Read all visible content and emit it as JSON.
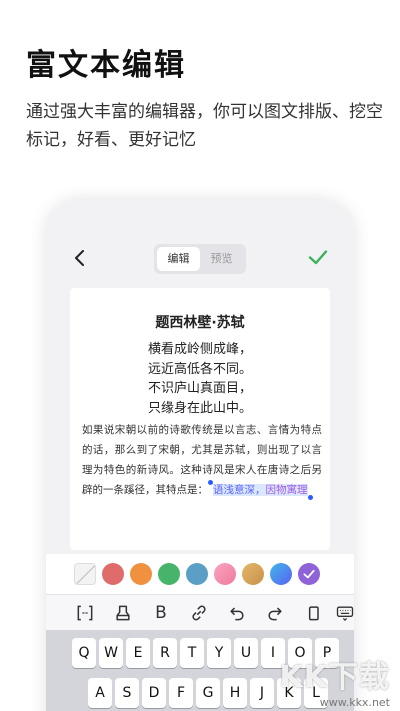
{
  "promo": {
    "title": "富文本编辑",
    "subtitle": "通过强大丰富的编辑器，你可以图文排版、挖空标记，好看、更好记忆"
  },
  "appbar": {
    "back_icon": "chevron-left-icon",
    "segments": [
      {
        "label": "编辑",
        "active": true
      },
      {
        "label": "预览",
        "active": false
      }
    ],
    "confirm_icon": "check-icon",
    "confirm_color": "#3cb15a"
  },
  "document": {
    "poem_title": "题西林壁·苏轼",
    "poem_lines": [
      "横看成岭侧成峰，",
      "远近高低各不同。",
      "不识庐山真面目，",
      "只缘身在此山中。"
    ],
    "paragraph_plain": "如果说宋朝以前的诗歌传统是以言志、言情为特点的话，那么到了宋朝，尤其是苏轼，则出现了以言理为特色的新诗风。这种诗风是宋人在唐诗之后另辟的一条蹊径，其特点是：",
    "highlight_part1": "语浅意深，",
    "highlight_part2": "因物寓理"
  },
  "palette": {
    "colors": [
      "#f3f3f3",
      "#e06b6b",
      "#f0913f",
      "#47b46b",
      "#5b9fc4",
      "#f38db0",
      "#d9a85a",
      "#4e8ff0",
      "#8e63d8"
    ],
    "selected_index": 8
  },
  "toolbar": {
    "icons": [
      "bracket-icon",
      "eraser-icon",
      "bold-icon",
      "link-icon",
      "undo-icon",
      "redo-icon",
      "clipboard-icon",
      "keyboard-icon"
    ],
    "bold_label": "B"
  },
  "keyboard": {
    "row1": [
      "Q",
      "W",
      "E",
      "R",
      "T",
      "Y",
      "U",
      "I",
      "O",
      "P"
    ],
    "row2": [
      "A",
      "S",
      "D",
      "F",
      "G",
      "H",
      "J",
      "K",
      "L"
    ]
  },
  "watermark": {
    "brand": "KK下载",
    "url": "www.kkx.net"
  }
}
